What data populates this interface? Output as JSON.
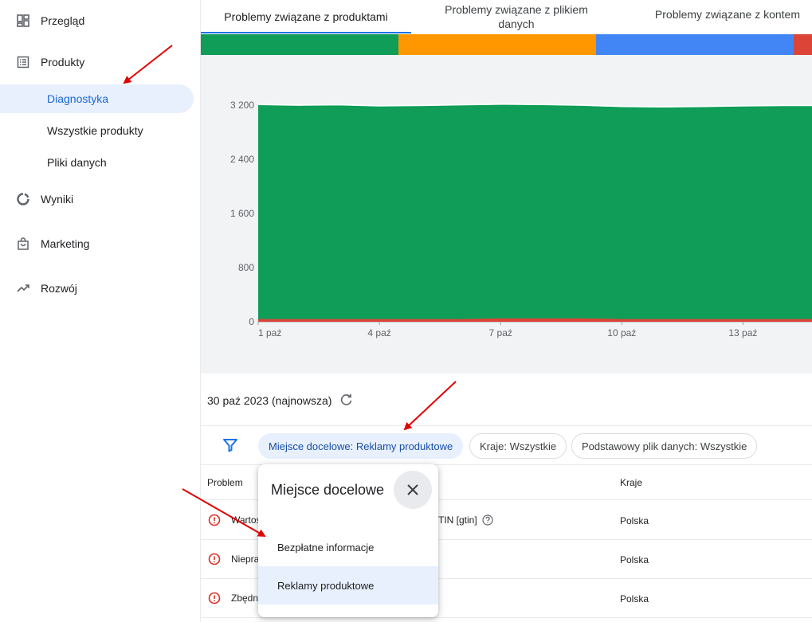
{
  "sidebar": {
    "items": [
      {
        "label": "Przegląd",
        "icon": "dashboard-icon"
      },
      {
        "label": "Produkty",
        "icon": "list-icon"
      },
      {
        "label": "Wyniki",
        "icon": "donut-icon"
      },
      {
        "label": "Marketing",
        "icon": "shopping-bag-icon"
      },
      {
        "label": "Rozwój",
        "icon": "trending-up-icon"
      }
    ],
    "sub_items": [
      {
        "label": "Diagnostyka",
        "active": true
      },
      {
        "label": "Wszystkie produkty",
        "active": false
      },
      {
        "label": "Pliki danych",
        "active": false
      }
    ]
  },
  "tabs": [
    {
      "label": "Problemy związane z produktami",
      "active": true
    },
    {
      "label": "Problemy związane z plikiem danych",
      "active": false
    },
    {
      "label": "Problemy związane z kontem",
      "active": false
    }
  ],
  "colors": {
    "green": "#0f9d58",
    "orange": "#ff9800",
    "blue": "#4285f4",
    "red": "#db4437",
    "accent": "#1a73e8",
    "arrow": "#e00000"
  },
  "chart_data": {
    "type": "area",
    "x": [
      "1 paź",
      "2 paź",
      "3 paź",
      "4 paź",
      "5 paź",
      "6 paź",
      "7 paź",
      "8 paź",
      "9 paź",
      "10 paź",
      "11 paź",
      "12 paź",
      "13 paź",
      "14 paź",
      "15 paź"
    ],
    "x_tick_labels": [
      "1 paź",
      "4 paź",
      "7 paź",
      "10 paź",
      "13 paź"
    ],
    "y_tick_labels": [
      "0",
      "800",
      "1 600",
      "2 400",
      "3 200"
    ],
    "ylim": [
      0,
      3200
    ],
    "grid": false,
    "series": [
      {
        "color": "#db4437",
        "values": [
          40,
          40,
          40,
          40,
          40,
          40,
          50,
          50,
          50,
          40,
          40,
          40,
          40,
          40,
          40
        ]
      },
      {
        "color": "#0f9d58",
        "values": [
          3200,
          3190,
          3195,
          3180,
          3185,
          3195,
          3205,
          3200,
          3190,
          3170,
          3165,
          3170,
          3180,
          3185,
          3185
        ]
      }
    ]
  },
  "date_row": {
    "text": "30 paź 2023 (najnowsza)"
  },
  "filters": [
    {
      "label": "Miejsce docelowe: Reklamy produktowe",
      "selected": true
    },
    {
      "label": "Kraje: Wszystkie",
      "selected": false
    },
    {
      "label": "Podstawowy plik danych: Wszystkie",
      "selected": false
    }
  ],
  "table": {
    "headers": {
      "problem": "Problem",
      "countries": "Kraje"
    },
    "rows": [
      {
        "problem": "Wartoś",
        "mid": "TIN [gtin]",
        "country": "Polska"
      },
      {
        "problem": "Niepra",
        "mid": "",
        "country": "Polska"
      },
      {
        "problem": "Zbędn",
        "mid": "",
        "country": "Polska"
      }
    ]
  },
  "popover": {
    "title": "Miejsce docelowe",
    "options": [
      {
        "label": "Bezpłatne informacje",
        "selected": false
      },
      {
        "label": "Reklamy produktowe",
        "selected": true
      }
    ]
  }
}
